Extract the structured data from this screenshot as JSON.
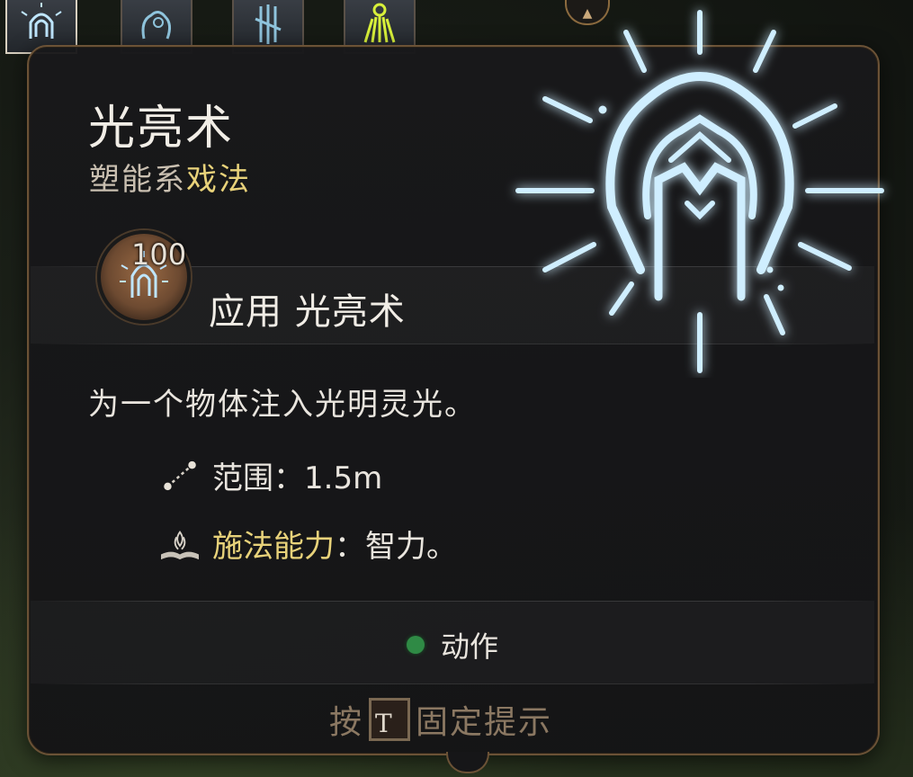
{
  "spell": {
    "title": "光亮术",
    "school": "塑能系",
    "type": "戏法"
  },
  "action": {
    "count": "100",
    "label": "应用 光亮术"
  },
  "description": "为一个物体注入光明灵光。",
  "properties": {
    "range_label": "范围：1.5m",
    "ability_key": "施法能力",
    "ability_value": "：智力。"
  },
  "cost": {
    "label": "动作",
    "color": "#2f8a45"
  },
  "hint": {
    "prefix": "按",
    "key": "T",
    "suffix": "固定提示"
  },
  "icons": [
    "spell-light-emblem",
    "range-icon",
    "spellbook-icon",
    "action-dot",
    "hotbar-spell-icons"
  ],
  "colors": {
    "accent_gold": "#e8d27a",
    "emblem_glow": "#bfe6ff",
    "panel_border": "#6b5236"
  }
}
